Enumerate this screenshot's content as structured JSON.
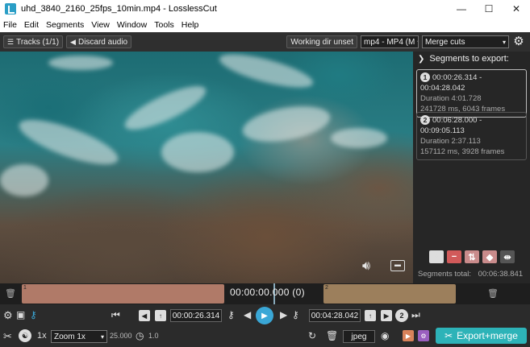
{
  "window": {
    "title": "uhd_3840_2160_25fps_10min.mp4 - LosslessCut",
    "minimize": "—",
    "maximize": "☐",
    "close": "✕"
  },
  "menu": [
    "File",
    "Edit",
    "Segments",
    "View",
    "Window",
    "Tools",
    "Help"
  ],
  "toolbar": {
    "tracks": "Tracks (1/1)",
    "discard_audio": "Discard audio",
    "working_dir": "Working dir unset",
    "format": "mp4 - MP4 (M",
    "merge_mode": "Merge cuts"
  },
  "panel": {
    "heading": "Segments to export:",
    "segments": [
      {
        "num": "1",
        "range": "00:00:26.314 - 00:04:28.042",
        "duration": "Duration 4:01.728",
        "frames": "241728 ms, 6043 frames"
      },
      {
        "num": "2",
        "range": "00:06:28.000 - 00:09:05.113",
        "duration": "Duration 2:37.113",
        "frames": "157112 ms, 3928 frames"
      }
    ],
    "total_label": "Segments total:",
    "total_value": "00:06:38.841"
  },
  "timeline": {
    "current_time": "00:00:00.000 (0)",
    "segment_labels": [
      "1",
      "2"
    ],
    "colors": {
      "segment1": "#b07a68",
      "segment2": "#9c7f5c"
    }
  },
  "controls": {
    "cut_start": "00:00:26.314",
    "cut_end": "00:04:28.042",
    "segment_count": "2",
    "speed": "1x",
    "zoom": "Zoom 1x",
    "fps": "25.000",
    "volume": "1.0",
    "snapshot_format": "jpeg",
    "export_label": "Export+merge",
    "accent": "#2db3b8"
  }
}
